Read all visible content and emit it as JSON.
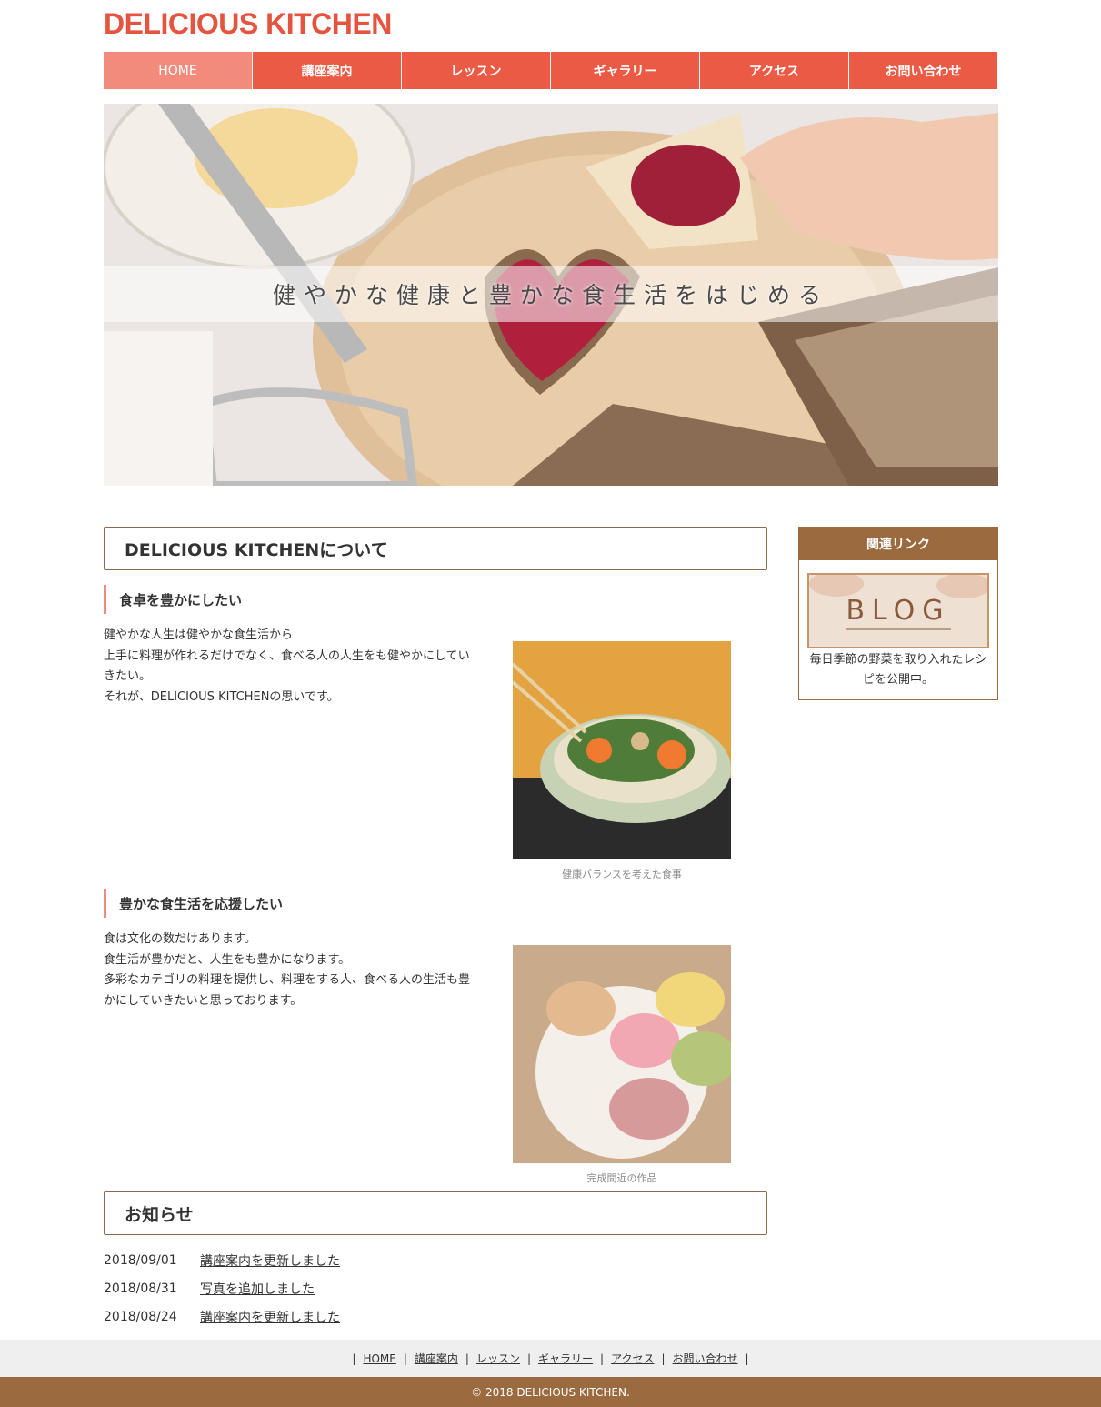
{
  "header": {
    "logo": "DELICIOUS KITCHEN"
  },
  "nav": {
    "items": [
      "HOME",
      "講座案内",
      "レッスン",
      "ギャラリー",
      "アクセス",
      "お問い合わせ"
    ]
  },
  "hero": {
    "tagline": "健やかな健康と豊かな食生活をはじめる"
  },
  "about": {
    "heading": "DELICIOUS KITCHENについて",
    "sections": [
      {
        "title": "食卓を豊かにしたい",
        "lines": [
          "健やかな人生は健やかな食生活から",
          "上手に料理が作れるだけでなく、食べる人の人生をも健やかにしてい",
          "きたい。",
          "それが、DELICIOUS KITCHENの思いです。"
        ],
        "caption": "健康バランスを考えた食事"
      },
      {
        "title": "豊かな食生活を応援したい",
        "lines": [
          "食は文化の数だけあります。",
          "食生活が豊かだと、人生をも豊かになります。",
          "多彩なカテゴリの料理を提供し、料理をする人、食べる人の生活も豊",
          "かにしていきたいと思っております。"
        ],
        "caption": "完成間近の作品"
      }
    ]
  },
  "news": {
    "heading": "お知らせ",
    "items": [
      {
        "date": "2018/09/01",
        "text": "講座案内を更新しました"
      },
      {
        "date": "2018/08/31",
        "text": "写真を追加しました"
      },
      {
        "date": "2018/08/24",
        "text": "講座案内を更新しました"
      }
    ]
  },
  "sidebar": {
    "heading": "関連リンク",
    "banner_text": "BLOG",
    "description_lines": [
      "毎日季節の野菜を取り入れたレシ",
      "ピを公開中。"
    ]
  },
  "footer": {
    "links": [
      "HOME",
      "講座案内",
      "レッスン",
      "ギャラリー",
      "アクセス",
      "お問い合わせ"
    ],
    "copyright": "© 2018 DELICIOUS KITCHEN."
  },
  "colors": {
    "accent": "#eb5a44",
    "nav_active": "#f28b7c",
    "brown": "#9b6a3f"
  }
}
